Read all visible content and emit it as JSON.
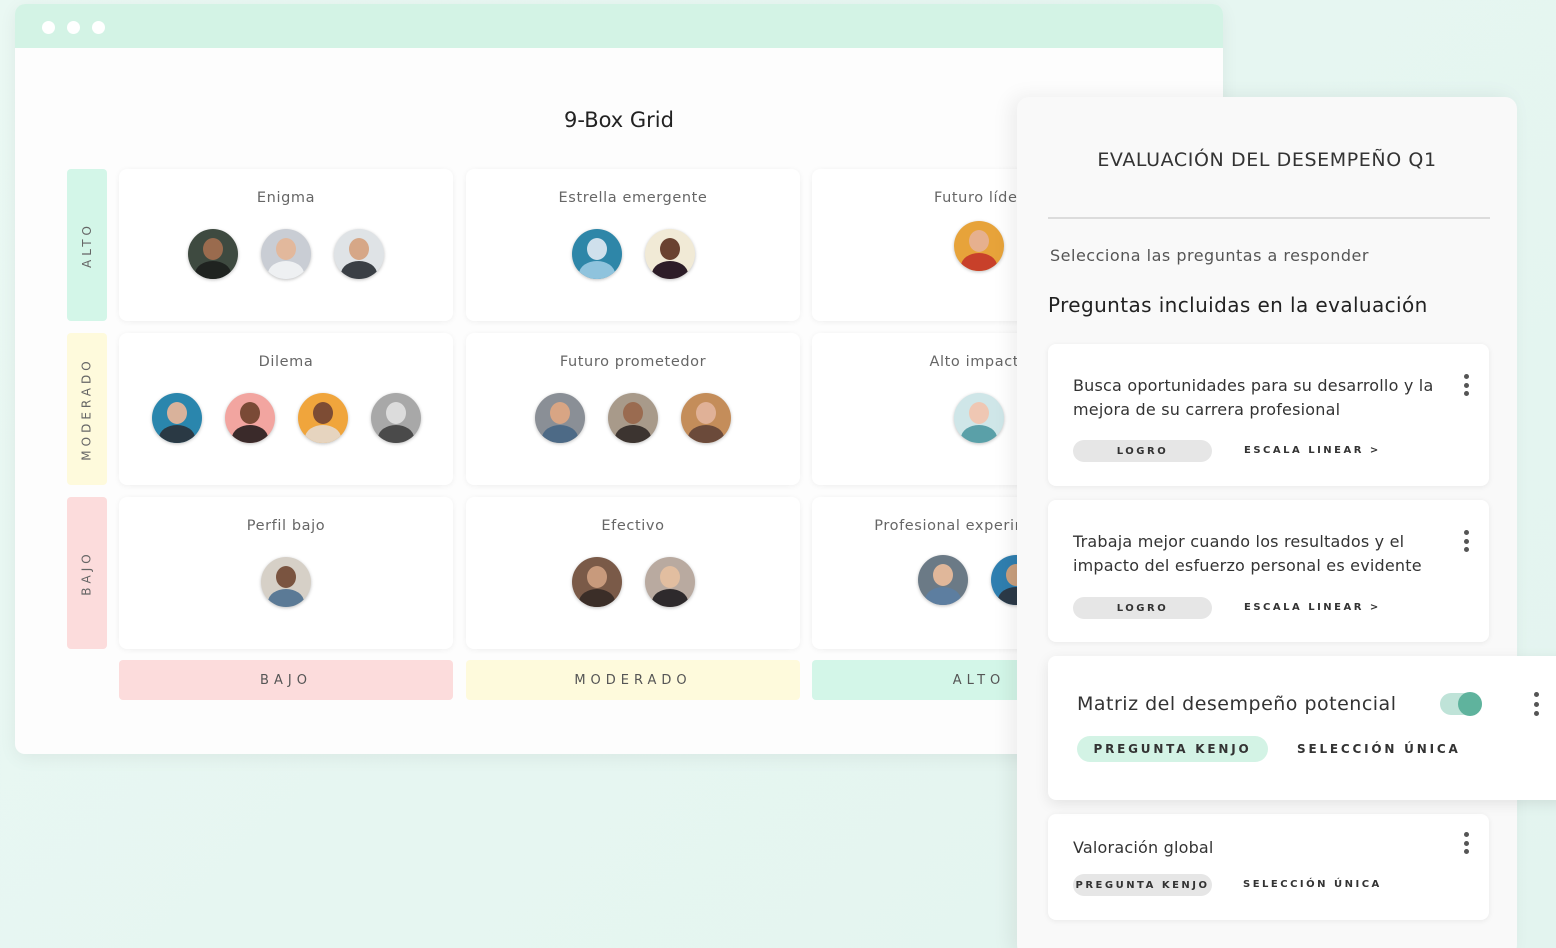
{
  "grid": {
    "title": "9-Box Grid",
    "rows": [
      {
        "label": "ALTO",
        "color": "#d3f6e8"
      },
      {
        "label": "MODERADO",
        "color": "#fefadc"
      },
      {
        "label": "BAJO",
        "color": "#fcdcdc"
      }
    ],
    "columns": [
      {
        "label": "BAJO",
        "color": "#fcdcdc"
      },
      {
        "label": "MODERADO",
        "color": "#fefadc"
      },
      {
        "label": "ALTO",
        "color": "#d3f6e8"
      }
    ],
    "cells": [
      {
        "title": "Enigma"
      },
      {
        "title": "Estrella emergente"
      },
      {
        "title": "Futuro líder"
      },
      {
        "title": "Dilema"
      },
      {
        "title": "Futuro prometedor"
      },
      {
        "title": "Alto impacto"
      },
      {
        "title": "Perfil bajo"
      },
      {
        "title": "Efectivo"
      },
      {
        "title": "Profesional experimentado"
      }
    ]
  },
  "panel": {
    "title": "EVALUACIÓN DEL DESEMPEÑO Q1",
    "subtitle": "Selecciona las preguntas a responder",
    "heading": "Preguntas incluidas en la evaluación",
    "questions": [
      {
        "text": "Busca oportunidades para su desarrollo y la mejora de su carrera profesional",
        "tag": "LOGRO",
        "type": "ESCALA LINEAR >"
      },
      {
        "text": "Trabaja mejor cuando los resultados y el impacto del esfuerzo personal es evidente",
        "tag": "LOGRO",
        "type": "ESCALA LINEAR >"
      },
      {
        "text": "Matriz del desempeño potencial",
        "tag": "PREGUNTA KENJO",
        "type": "SELECCIÓN ÚNICA",
        "enabled": true
      },
      {
        "text": "Valoración global",
        "tag": "PREGUNTA KENJO",
        "type": "SELECCIÓN ÚNICA"
      }
    ]
  },
  "colors": {
    "accent": "#5fb39d",
    "accent_light": "#d3f3e5",
    "tag_gray": "#e6e6e6"
  }
}
